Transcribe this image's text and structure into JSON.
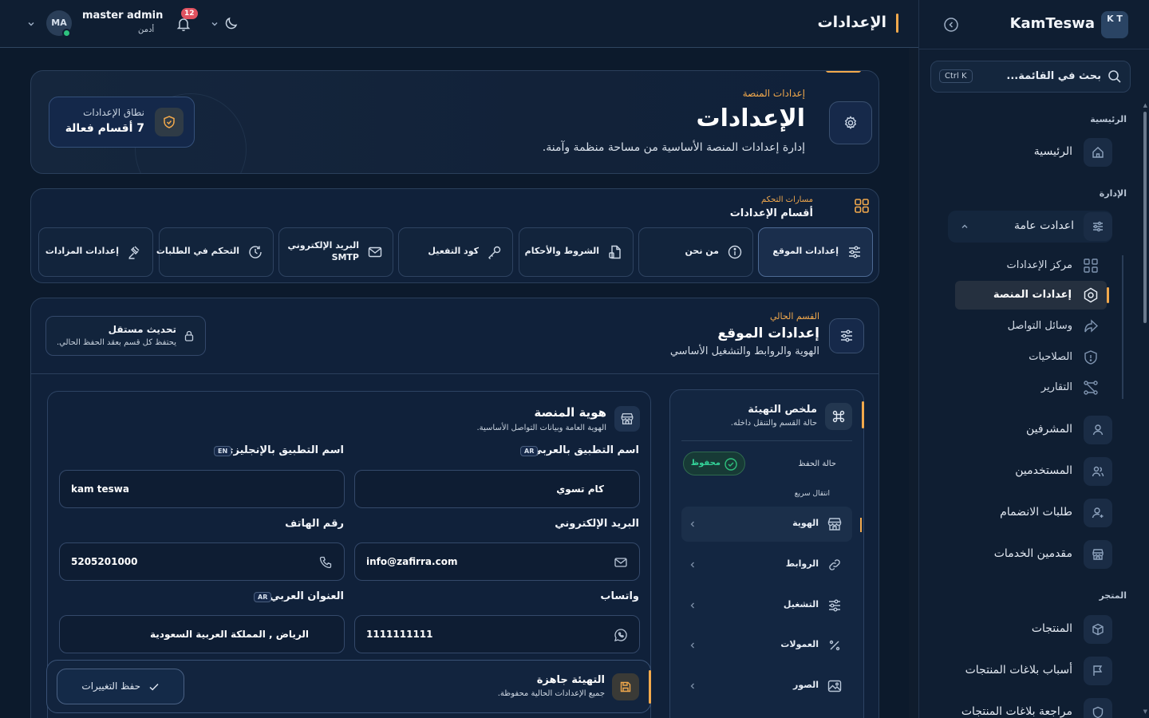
{
  "sidebar": {
    "logo_text": "K T",
    "app_name": "KamTeswa",
    "search": {
      "placeholder": "بحث في القائمة...",
      "shortcut": "Ctrl K"
    },
    "sections": {
      "home": "الرئيسية",
      "admin": "الإدارة",
      "store": "المتجر"
    },
    "items": {
      "home": "الرئيسية",
      "general_settings": "اعدادت عامة",
      "sub_settings_center": "مركز الإعدادات",
      "sub_platform_settings": "إعدادات المنصة",
      "sub_social": "وسائل التواصل",
      "sub_permissions": "الصلاحيات",
      "sub_reports": "التقارير",
      "supervisors": "المشرفين",
      "users": "المستخدمين",
      "join_requests": "طلبات الانضمام",
      "service_providers": "مقدمين الخدمات",
      "products": "المنتجات",
      "product_report_reasons": "أسباب بلاغات المنتجات",
      "product_report_review": "مراجعة بلاغات المنتجات"
    }
  },
  "header": {
    "title": "الإعدادات",
    "notifications_count": "12",
    "user": {
      "name": "master admin",
      "role": "أدمن",
      "initials": "MA"
    }
  },
  "hero": {
    "kicker": "إعدادات المنصة",
    "title": "الإعدادات",
    "description": "إدارة إعدادات المنصة الأساسية من مساحة منظمة وآمنة.",
    "scope_label": "نطاق الإعدادات",
    "scope_value": "7 أقسام فعالة"
  },
  "tabs": {
    "kicker": "مسارات التحكم",
    "title": "أقسام الإعدادات",
    "items": [
      {
        "label": "إعدادات الموقع"
      },
      {
        "label": "من نحن"
      },
      {
        "label": "الشروط والأحكام"
      },
      {
        "label": "كود التفعيل"
      },
      {
        "label_line1": "البريد الإلكتروني",
        "label_line2": "SMTP"
      },
      {
        "label": "التحكم في الطلبات"
      },
      {
        "label": "إعدادات المزادات"
      }
    ]
  },
  "section": {
    "kicker": "القسم الحالي",
    "title": "إعدادات الموقع",
    "description": "الهوية والروابط والتشغيل الأساسي",
    "independent_title": "تحديث مستقل",
    "independent_desc": "يحتفظ كل قسم بعقد الحفظ الحالي."
  },
  "summary": {
    "title": "ملخص التهيئة",
    "subtitle": "حالة القسم والتنقل داخله.",
    "save_state_label": "حالة الحفظ",
    "save_state_value": "محفوظ",
    "quick_nav_label": "انتقال سريع",
    "quick_items": [
      "الهوية",
      "الروابط",
      "التشغيل",
      "العمولات",
      "الصور"
    ]
  },
  "form": {
    "title": "هوية المنصة",
    "subtitle": "الهوية العامة وبيانات التواصل الأساسية.",
    "fields": {
      "app_name_ar": {
        "label": "اسم التطبيق بالعربي",
        "tag": "AR",
        "value": "كام تسوي"
      },
      "app_name_en": {
        "label": "اسم التطبيق بالإنجليزي",
        "tag": "EN",
        "value": "kam teswa"
      },
      "email": {
        "label": "البريد الإلكتروني",
        "value": "info@zafirra.com"
      },
      "phone": {
        "label": "رقم الهاتف",
        "value": "5205201000"
      },
      "whatsapp": {
        "label": "واتساب",
        "value": "1111111111"
      },
      "address_ar": {
        "label": "العنوان العربي",
        "tag": "AR",
        "value": "الرياض , المملكة العربية السعودية"
      }
    }
  },
  "save_bar": {
    "title": "التهيئة جاهزة",
    "subtitle": "جميع الإعدادات الحالية محفوظة.",
    "button": "حفظ التغييرات"
  },
  "colors": {
    "background": "#0c1a2c",
    "panel": "#10213a",
    "accent": "#f2a94c",
    "success": "#2ec27e",
    "badge": "#e05260"
  }
}
